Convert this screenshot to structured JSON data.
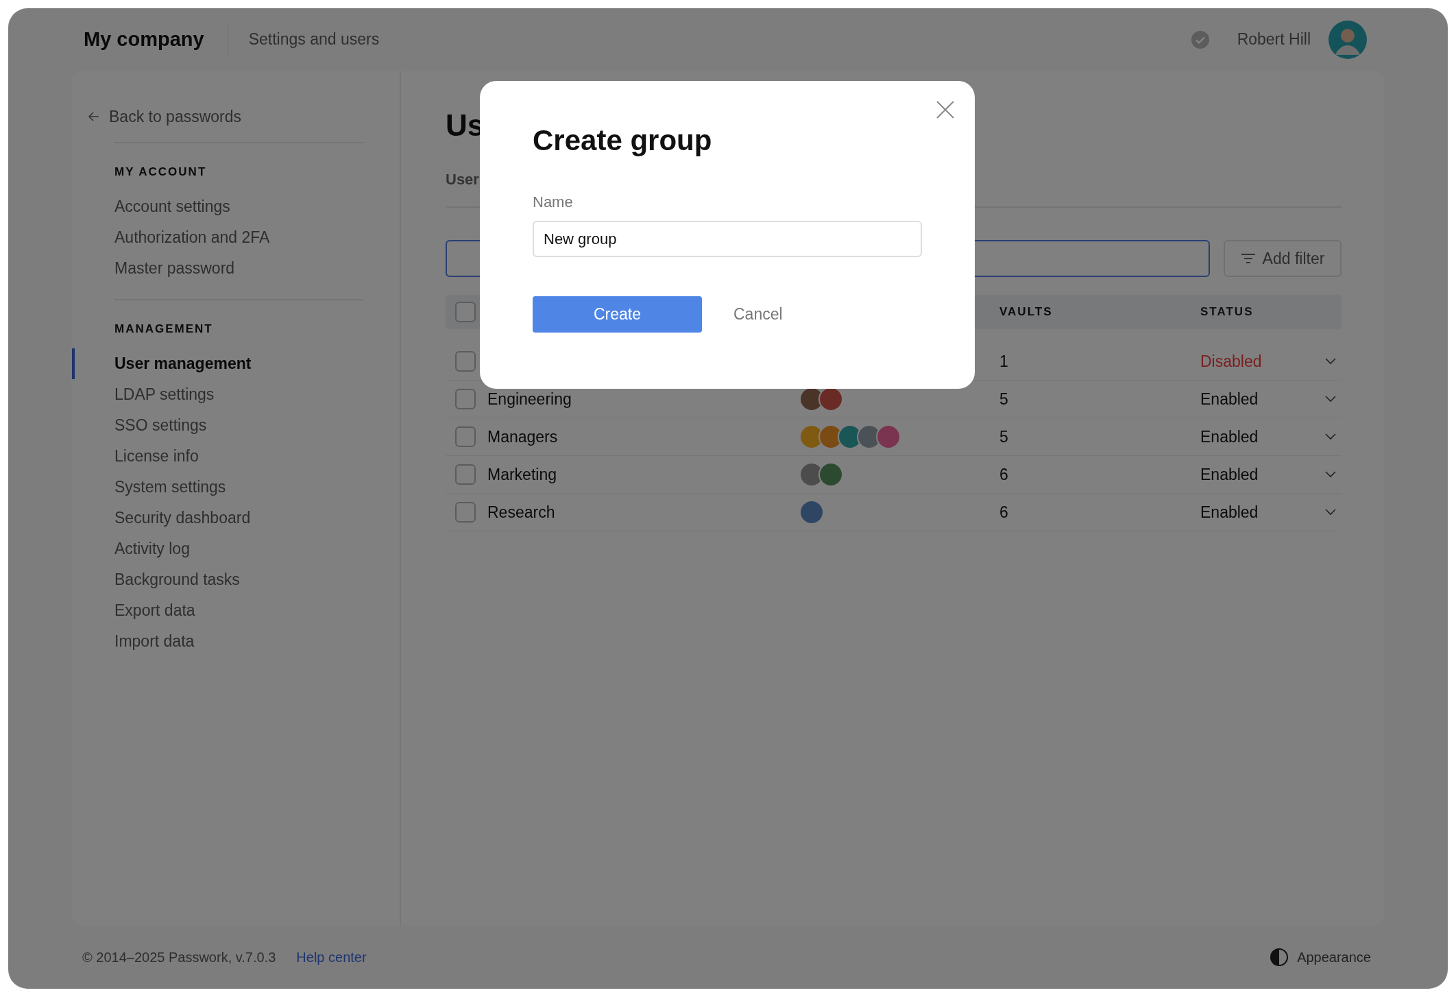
{
  "topbar": {
    "company": "My company",
    "section": "Settings and users",
    "user_name": "Robert Hill"
  },
  "sidebar": {
    "back_link": "Back to passwords",
    "sections": [
      {
        "heading": "MY ACCOUNT",
        "items": [
          {
            "label": "Account settings",
            "selected": false
          },
          {
            "label": "Authorization and 2FA",
            "selected": false
          },
          {
            "label": "Master password",
            "selected": false
          }
        ]
      },
      {
        "heading": "MANAGEMENT",
        "items": [
          {
            "label": "User management",
            "selected": true
          },
          {
            "label": "LDAP settings",
            "selected": false
          },
          {
            "label": "SSO settings",
            "selected": false
          },
          {
            "label": "License info",
            "selected": false
          },
          {
            "label": "System settings",
            "selected": false
          },
          {
            "label": "Security dashboard",
            "selected": false
          },
          {
            "label": "Activity log",
            "selected": false
          },
          {
            "label": "Background tasks",
            "selected": false
          },
          {
            "label": "Export data",
            "selected": false
          },
          {
            "label": "Import data",
            "selected": false
          }
        ]
      }
    ]
  },
  "main": {
    "title": "Us",
    "tab": "User",
    "add_filter": "Add filter",
    "table": {
      "header_checked": false,
      "vaults_column": "VAULTS",
      "status_column": "STATUS",
      "rows": [
        {
          "checked": false,
          "vaults": "1",
          "status": "Disabled",
          "kind": "disabled"
        },
        {
          "checked": false,
          "name": "Engineering",
          "avatars": [
            {
              "color": "#4a3428"
            },
            {
              "color": "#6a2a26"
            }
          ],
          "vaults": "5",
          "status": "Enabled",
          "kind": "enabled"
        },
        {
          "checked": false,
          "name": "Managers",
          "avatars": [
            {
              "color": "#805a10"
            },
            {
              "color": "#7a4c14"
            },
            {
              "color": "#1a5656"
            },
            {
              "color": "#4a5258"
            },
            {
              "color": "#7a3450"
            }
          ],
          "vaults": "5",
          "status": "Enabled",
          "kind": "enabled"
        },
        {
          "checked": false,
          "name": "Marketing",
          "avatars": [
            {
              "color": "#4c4c4c"
            },
            {
              "color": "#2c4a30"
            }
          ],
          "vaults": "6",
          "status": "Enabled",
          "kind": "enabled"
        },
        {
          "checked": false,
          "name": "Research",
          "avatars": [
            {
              "color": "#2e4664"
            }
          ],
          "vaults": "6",
          "status": "Enabled",
          "kind": "enabled"
        }
      ]
    }
  },
  "dialog": {
    "title": "Create group",
    "field_label": "Name",
    "field_value": "New group",
    "create": "Create",
    "cancel": "Cancel"
  },
  "footer": {
    "copyright": "© 2014–2025 Passwork, v.7.0.3",
    "help": "Help center",
    "appearance": "Appearance"
  }
}
